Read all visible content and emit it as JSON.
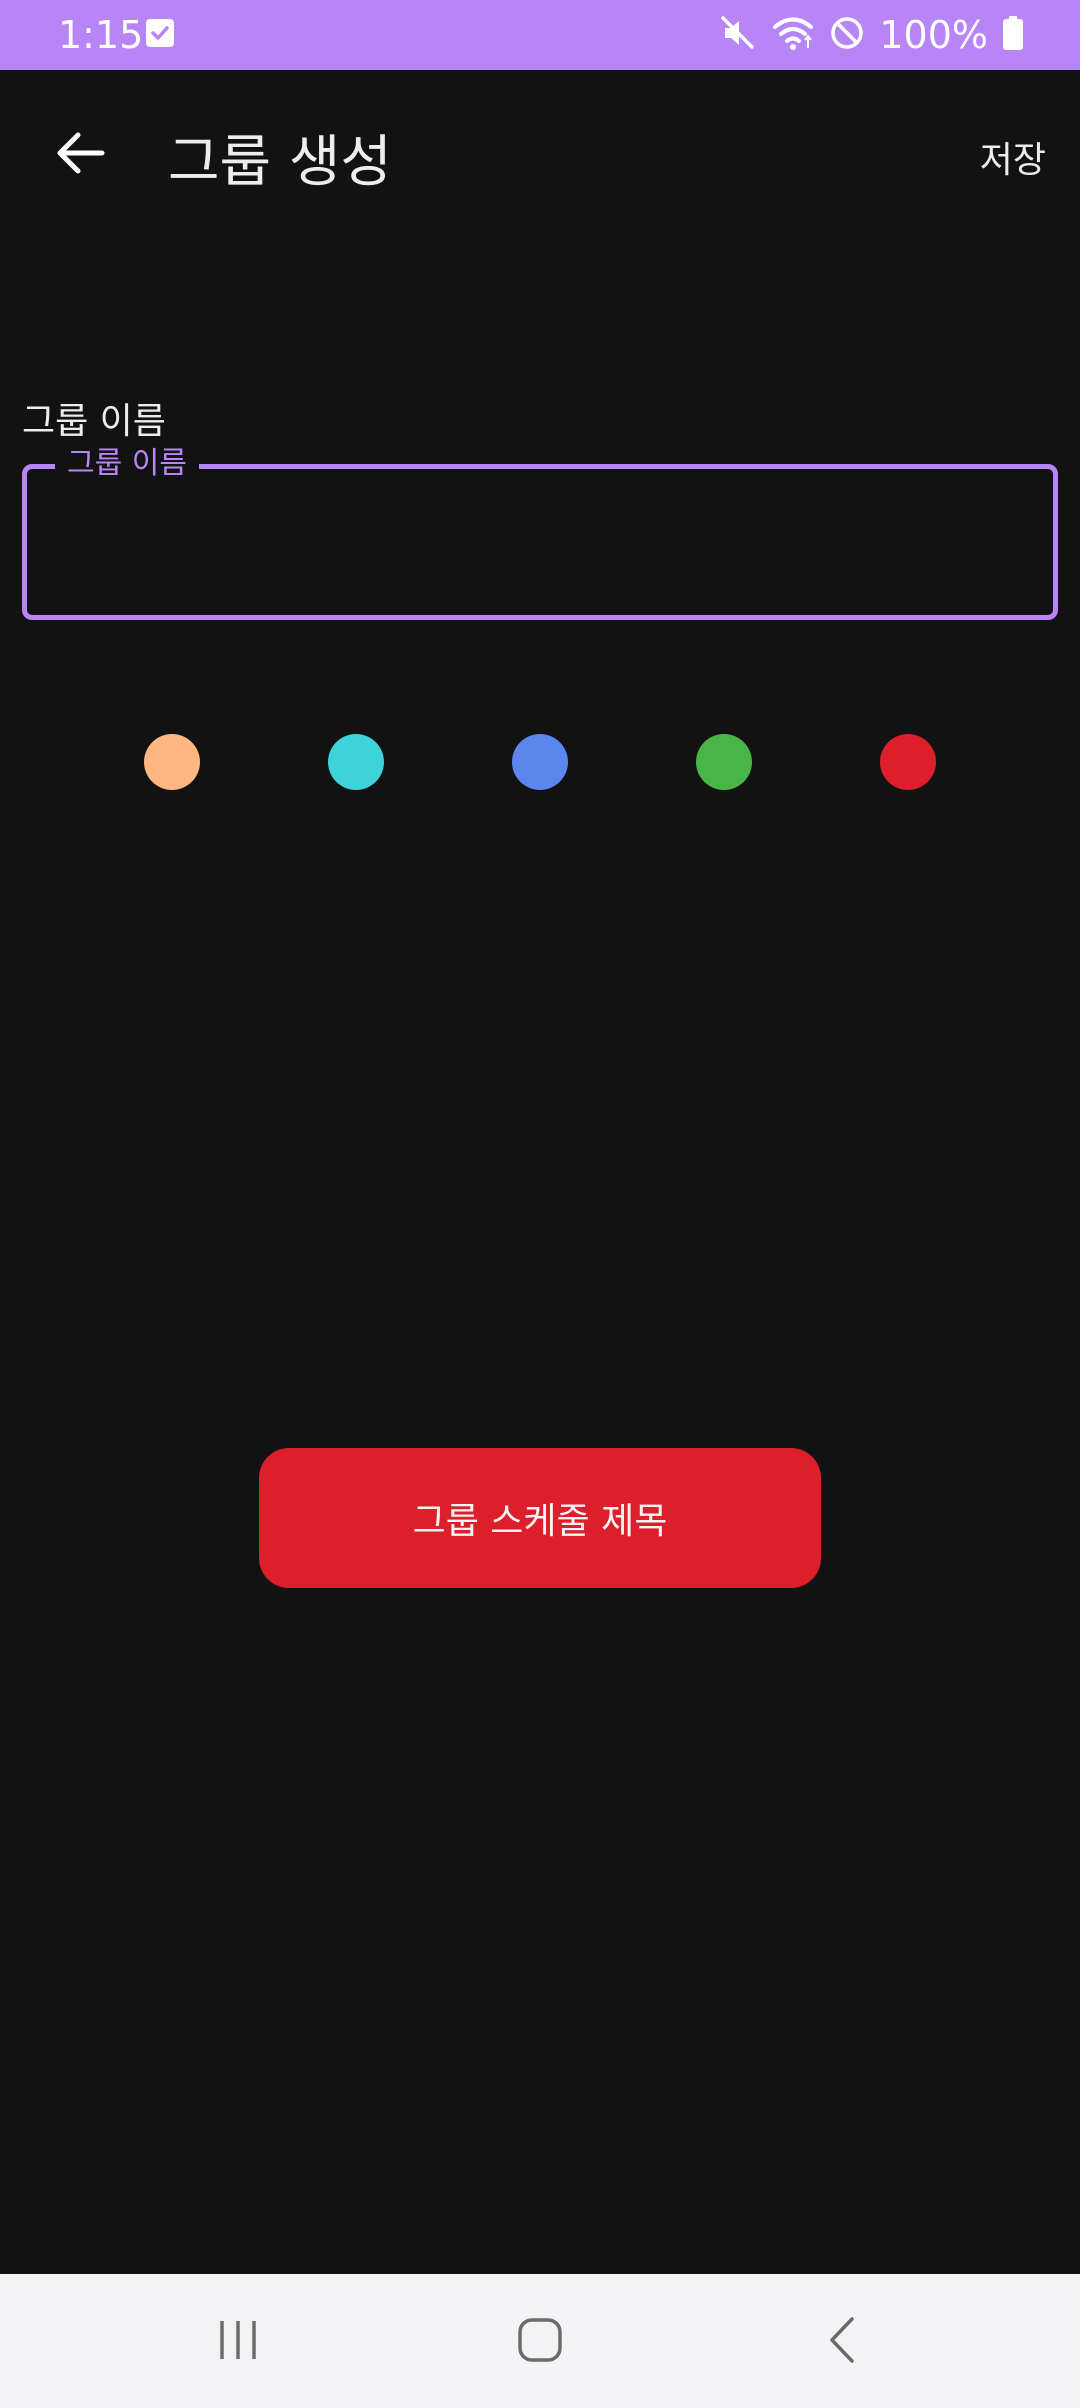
{
  "status_bar": {
    "time": "1:15",
    "battery": "100%",
    "background": "#b785f5"
  },
  "app_bar": {
    "title": "그룹 생성",
    "save_label": "저장",
    "back_icon": "arrow-left-icon"
  },
  "form": {
    "field_label": "그룹 이름",
    "floating_label": "그룹 이름",
    "value": "",
    "accent": "#b785f5"
  },
  "colors": {
    "swatches": [
      "#ffb680",
      "#3ed2d9",
      "#5b86ee",
      "#4ab547",
      "#dc1f2a"
    ]
  },
  "button": {
    "label": "그룹 스케줄 제목",
    "color": "#dc1f2a"
  },
  "nav": {
    "recent_icon": "recent-apps-icon",
    "home_icon": "home-icon",
    "back_icon": "back-chevron-icon"
  }
}
